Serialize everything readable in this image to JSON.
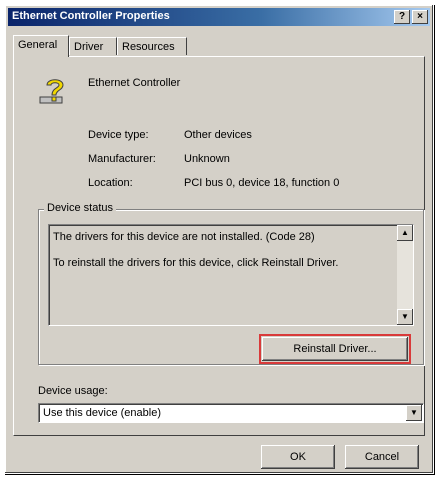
{
  "window": {
    "title": "Ethernet Controller Properties",
    "help_label": "?",
    "close_label": "×"
  },
  "tabs": [
    {
      "label": "General",
      "active": true
    },
    {
      "label": "Driver",
      "active": false
    },
    {
      "label": "Resources",
      "active": false
    }
  ],
  "device": {
    "icon": "unknown-device-question-icon",
    "name": "Ethernet Controller"
  },
  "properties": [
    {
      "label": "Device type:",
      "value": "Other devices"
    },
    {
      "label": "Manufacturer:",
      "value": "Unknown"
    },
    {
      "label": "Location:",
      "value": "PCI bus 0, device 18, function 0"
    }
  ],
  "device_status": {
    "title": "Device status",
    "lines": [
      "The drivers for this device are not installed. (Code 28)",
      "To reinstall the drivers for this device, click Reinstall Driver."
    ],
    "reinstall_label": "Reinstall Driver..."
  },
  "device_usage": {
    "label": "Device usage:",
    "selected": "Use this device (enable)"
  },
  "footer": {
    "ok_label": "OK",
    "cancel_label": "Cancel"
  },
  "colors": {
    "title_start": "#0a246a",
    "title_end": "#a6caf0",
    "face": "#d4d0c8",
    "highlight": "#d93a3a"
  }
}
